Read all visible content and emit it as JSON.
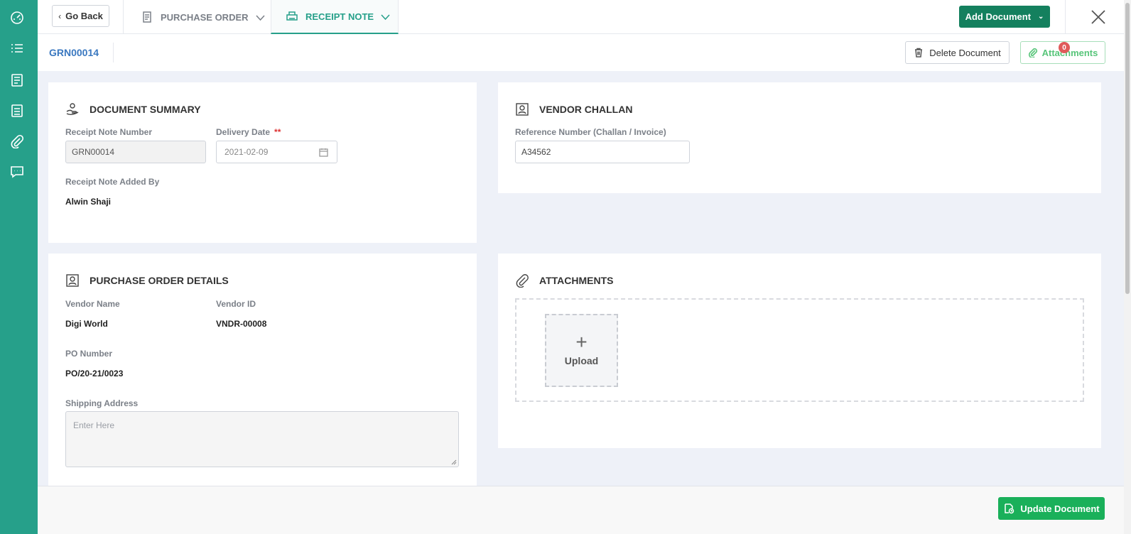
{
  "colors": {
    "sidebar": "#26a08a",
    "accent": "#26a08a",
    "primary_button": "#14805e",
    "update_button": "#1ab05a",
    "link_blue": "#3a78c0",
    "required": "#dd3333",
    "badge": "#e05a5a"
  },
  "sidebar": {
    "icons": [
      "dashboard-icon",
      "list-icon",
      "document-list-icon",
      "report-icon",
      "attachment-icon",
      "chat-icon"
    ]
  },
  "topbar": {
    "go_back": "Go Back",
    "tabs": [
      {
        "label": "PURCHASE ORDER",
        "icon": "document-icon",
        "active": false
      },
      {
        "label": "RECEIPT NOTE",
        "icon": "printer-icon",
        "active": true
      }
    ],
    "add_document": "Add Document"
  },
  "subheader": {
    "grn_id": "GRN00014",
    "delete_document": "Delete Document",
    "attachments": "Attachments",
    "attachments_count": "0"
  },
  "document_summary": {
    "title": "DOCUMENT SUMMARY",
    "receipt_note_number_label": "Receipt Note Number",
    "receipt_note_number": "GRN00014",
    "delivery_date_label": "Delivery Date",
    "required_mark": "**",
    "delivery_date": "2021-02-09",
    "added_by_label": "Receipt Note Added By",
    "added_by": "Alwin Shaji"
  },
  "vendor_challan": {
    "title": "VENDOR CHALLAN",
    "reference_label": "Reference Number (Challan / Invoice)",
    "reference_value": "A34562"
  },
  "po_details": {
    "title": "PURCHASE ORDER DETAILS",
    "vendor_name_label": "Vendor Name",
    "vendor_name": "Digi World",
    "vendor_id_label": "Vendor ID",
    "vendor_id": "VNDR-00008",
    "po_number_label": "PO Number",
    "po_number": "PO/20-21/0023",
    "shipping_address_label": "Shipping Address",
    "shipping_address_placeholder": "Enter Here"
  },
  "attachments_section": {
    "title": "ATTACHMENTS",
    "upload_label": "Upload"
  },
  "footer": {
    "update_document": "Update Document"
  }
}
